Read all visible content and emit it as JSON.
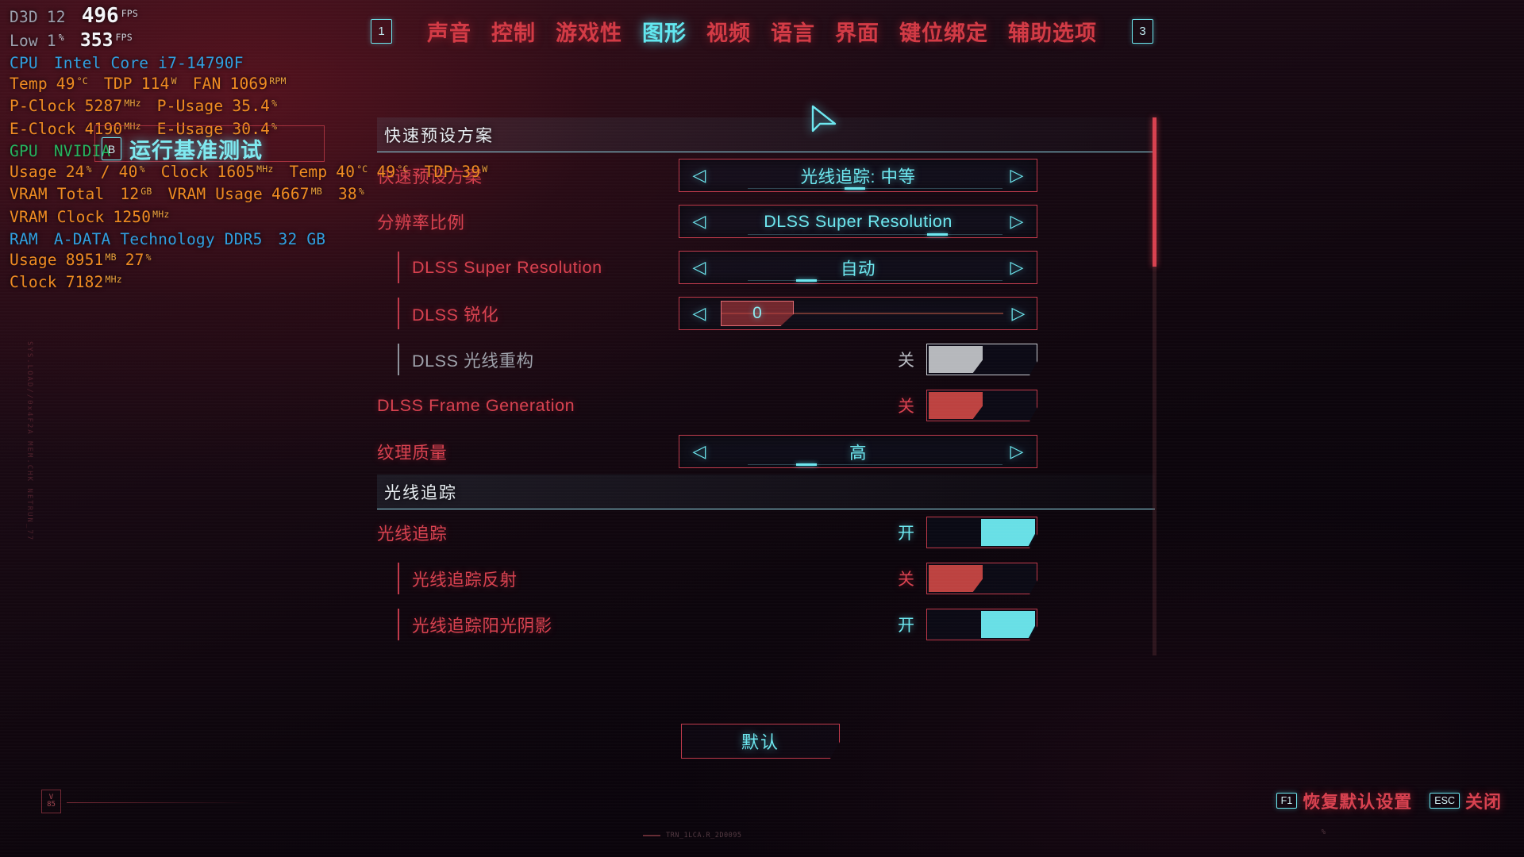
{
  "osd": {
    "api_label": "D3D",
    "api_version": "12",
    "fps_value": "496",
    "fps_unit": "FPS",
    "low_label": "Low",
    "low_num": "1",
    "low_pct": "%",
    "low_value": "353",
    "low_unit": "FPS",
    "cpu_label": "CPU",
    "cpu_name": "Intel Core i7-14790F",
    "cpu_temp_label": "Temp",
    "cpu_temp_value": "49",
    "cpu_temp_unit": "°C",
    "cpu_tdp_label": "TDP",
    "cpu_tdp_value": "114",
    "cpu_tdp_unit": "W",
    "cpu_fan_label": "FAN",
    "cpu_fan_value": "1069",
    "cpu_fan_unit": "RPM",
    "pclock_label": "P-Clock",
    "pclock_value": "5287",
    "pclock_unit": "MHz",
    "pusage_label": "P-Usage",
    "pusage_value": "35.4",
    "pusage_unit": "%",
    "eclock_label": "E-Clock",
    "eclock_value": "4190",
    "eclock_unit": "MHz",
    "eusage_label": "E-Usage",
    "eusage_value": "30.4",
    "eusage_unit": "%",
    "gpu_label": "GPU",
    "gpu_name": "NVIDIA",
    "gpu_usage_label": "Usage",
    "gpu_usage_1": "24",
    "gpu_usage_sep": "/",
    "gpu_usage_2": "40",
    "gpu_usage_unit": "%",
    "gpu_clock_label": "Clock",
    "gpu_clock_value": "1605",
    "gpu_clock_unit": "MHz",
    "gpu_temp_label": "Temp",
    "gpu_temp_1": "40",
    "gpu_temp_2": "49",
    "gpu_temp_unit": "°C",
    "gpu_tdp_label": "TDP",
    "gpu_tdp_value": "39",
    "gpu_tdp_unit": "W",
    "vram_total_label": "VRAM Total",
    "vram_total_value": "12",
    "vram_total_unit": "GB",
    "vram_usage_label": "VRAM Usage",
    "vram_usage_value": "4667",
    "vram_usage_unit": "MB",
    "vram_usage_pct": "38",
    "vram_usage_pct_unit": "%",
    "vram_clock_label": "VRAM Clock",
    "vram_clock_value": "1250",
    "vram_clock_unit": "MHz",
    "ram_label": "RAM",
    "ram_name": "A-DATA Technology DDR5",
    "ram_size": "32 GB",
    "ram_usage_label": "Usage",
    "ram_usage_value": "8951",
    "ram_usage_unit": "MB",
    "ram_usage_pct": "27",
    "ram_usage_pct_unit": "%",
    "ram_clock_label": "Clock",
    "ram_clock_value": "7182",
    "ram_clock_unit": "MHz"
  },
  "topnav": {
    "left_key": "1",
    "right_key": "3",
    "tabs": [
      {
        "label": "声音",
        "active": false
      },
      {
        "label": "控制",
        "active": false
      },
      {
        "label": "游戏性",
        "active": false
      },
      {
        "label": "图形",
        "active": true
      },
      {
        "label": "视频",
        "active": false
      },
      {
        "label": "语言",
        "active": false
      },
      {
        "label": "界面",
        "active": false
      },
      {
        "label": "键位绑定",
        "active": false
      },
      {
        "label": "辅助选项",
        "active": false
      }
    ]
  },
  "benchmark_hint": {
    "key": "B",
    "label": "运行基准测试"
  },
  "panel": {
    "sections": [
      {
        "title": "快速预设方案",
        "rows": [
          {
            "label": "快速预设方案",
            "type": "selector",
            "value": "光线追踪: 中等",
            "indent": false,
            "disabled": false
          },
          {
            "label": "分辨率比例",
            "type": "selector",
            "value": "DLSS Super Resolution",
            "indent": false,
            "disabled": false
          },
          {
            "label": "DLSS Super Resolution",
            "type": "selector",
            "value": "自动",
            "indent": true,
            "disabled": false
          },
          {
            "label": "DLSS 锐化",
            "type": "slider",
            "value": "0",
            "indent": true,
            "disabled": false
          },
          {
            "label": "DLSS 光线重构",
            "type": "toggle",
            "value": "关",
            "state": "off",
            "indent": true,
            "disabled": true
          },
          {
            "label": "DLSS Frame Generation",
            "type": "toggle",
            "value": "关",
            "state": "off",
            "indent": false,
            "disabled": false
          },
          {
            "label": "纹理质量",
            "type": "selector",
            "value": "高",
            "indent": false,
            "disabled": false
          }
        ]
      },
      {
        "title": "光线追踪",
        "rows": [
          {
            "label": "光线追踪",
            "type": "toggle",
            "value": "开",
            "state": "on",
            "indent": false,
            "disabled": false
          },
          {
            "label": "光线追踪反射",
            "type": "toggle",
            "value": "关",
            "state": "off",
            "indent": true,
            "disabled": false
          },
          {
            "label": "光线追踪阳光阴影",
            "type": "toggle",
            "value": "开",
            "state": "on",
            "indent": true,
            "disabled": false
          }
        ]
      }
    ]
  },
  "default_button": {
    "label": "默认"
  },
  "footer": {
    "hints": [
      {
        "key": "F1",
        "label": "恢复默认设置"
      },
      {
        "key": "ESC",
        "label": "关闭"
      }
    ]
  },
  "decor": {
    "badge_line1": "V",
    "badge_line2": "85",
    "bottom_code": "TRN_1LCA.R_2D0095",
    "bottom_tick": "%",
    "code_strip": "SYS.LOAD//0x4F2A  MEM.CHK  NETRUN_77"
  },
  "colors": {
    "accent_red": "#d8414f",
    "accent_cyan": "#6de7ef",
    "toggle_on": "#68dfe6",
    "toggle_off": "#bd4240",
    "toggle_disabled": "#b6b8bc",
    "osd_value": "#ef8b21",
    "osd_cpu": "#2f9fe0",
    "osd_gpu": "#24b45e"
  }
}
